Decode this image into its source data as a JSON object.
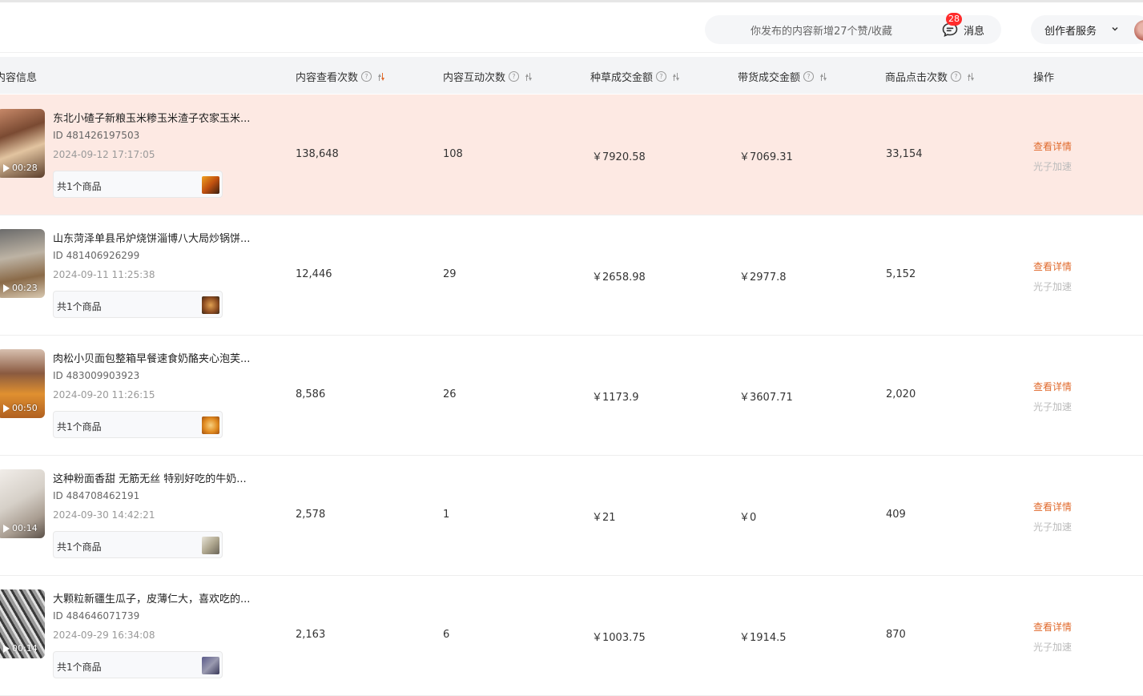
{
  "header": {
    "notice": "你发布的内容新增27个赞/收藏",
    "message_label": "消息",
    "message_badge": "28",
    "creator_service": "创作者服务"
  },
  "columns": {
    "content_info": "内容信息",
    "views": "内容查看次数",
    "interactions": "内容互动次数",
    "seeding_gmv": "种草成交金额",
    "sales_gmv": "带货成交金额",
    "product_clicks": "商品点击次数",
    "actions": "操作"
  },
  "rows": [
    {
      "title": "东北小碴子新粮玉米糁玉米渣子农家玉米...",
      "id": "ID 481426197503",
      "date": "2024-09-12 17:17:05",
      "duration": "00:28",
      "goods": "共1个商品",
      "views": "138,648",
      "interactions": "108",
      "seeding_gmv": "￥7920.58",
      "sales_gmv": "￥7069.31",
      "product_clicks": "33,154",
      "action_detail": "查看详情",
      "action_boost": "光子加速"
    },
    {
      "title": "山东菏泽单县吊炉烧饼淄博八大局炒锅饼...",
      "id": "ID 481406926299",
      "date": "2024-09-11 11:25:38",
      "duration": "00:23",
      "goods": "共1个商品",
      "views": "12,446",
      "interactions": "29",
      "seeding_gmv": "￥2658.98",
      "sales_gmv": "￥2977.8",
      "product_clicks": "5,152",
      "action_detail": "查看详情",
      "action_boost": "光子加速"
    },
    {
      "title": "肉松小贝面包整箱早餐速食奶酪夹心泡芙...",
      "id": "ID 483009903923",
      "date": "2024-09-20 11:26:15",
      "duration": "00:50",
      "goods": "共1个商品",
      "views": "8,586",
      "interactions": "26",
      "seeding_gmv": "￥1173.9",
      "sales_gmv": "￥3607.71",
      "product_clicks": "2,020",
      "action_detail": "查看详情",
      "action_boost": "光子加速"
    },
    {
      "title": "这种粉面香甜 无筋无丝 特别好吃的牛奶...",
      "id": "ID 484708462191",
      "date": "2024-09-30 14:42:21",
      "duration": "00:14",
      "goods": "共1个商品",
      "views": "2,578",
      "interactions": "1",
      "seeding_gmv": "￥21",
      "sales_gmv": "￥0",
      "product_clicks": "409",
      "action_detail": "查看详情",
      "action_boost": "光子加速"
    },
    {
      "title": "大颗粒新疆生瓜子，皮薄仁大，喜欢吃的...",
      "id": "ID 484646071739",
      "date": "2024-09-29 16:34:08",
      "duration": "00:14",
      "goods": "共1个商品",
      "views": "2,163",
      "interactions": "6",
      "seeding_gmv": "￥1003.75",
      "sales_gmv": "￥1914.5",
      "product_clicks": "870",
      "action_detail": "查看详情",
      "action_boost": "光子加速"
    }
  ]
}
